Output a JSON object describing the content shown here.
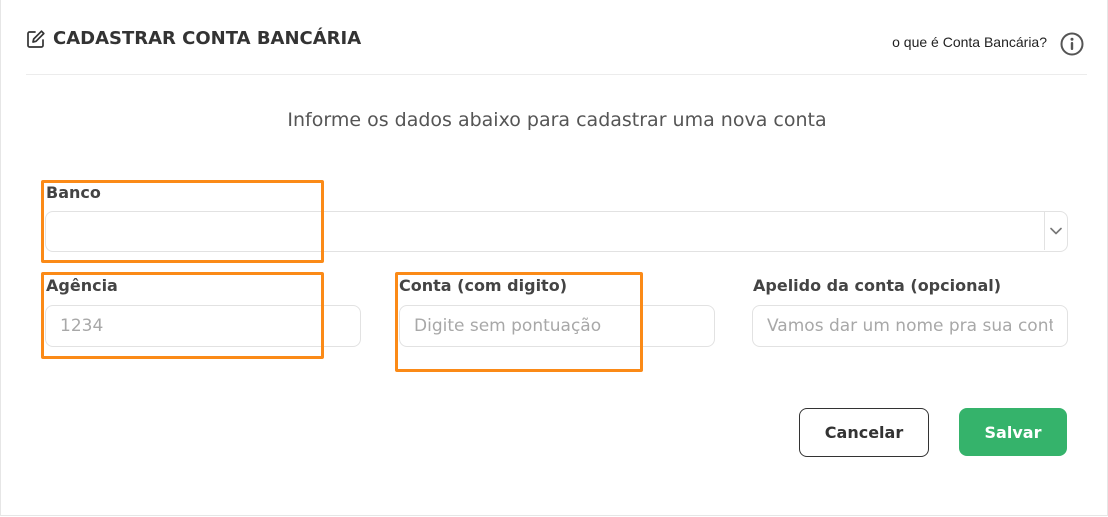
{
  "header": {
    "title": "CADASTRAR CONTA BANCÁRIA",
    "help_link": "o que é Conta Bancária?",
    "edit_icon": "edit-icon",
    "info_icon": "info-icon"
  },
  "subtitle": "Informe os dados abaixo para cadastrar uma nova conta",
  "form": {
    "banco": {
      "label": "Banco",
      "value": ""
    },
    "agencia": {
      "label": "Agência",
      "placeholder": "1234",
      "value": ""
    },
    "conta": {
      "label": "Conta (com digito)",
      "placeholder": "Digite sem pontuação",
      "value": ""
    },
    "apelido": {
      "label": "Apelido da conta (opcional)",
      "placeholder": "Vamos dar um nome pra sua conta",
      "value": ""
    }
  },
  "actions": {
    "cancel_label": "Cancelar",
    "save_label": "Salvar"
  },
  "colors": {
    "primary": "#35b36b",
    "highlight": "#fb8a17",
    "text": "#333333"
  }
}
